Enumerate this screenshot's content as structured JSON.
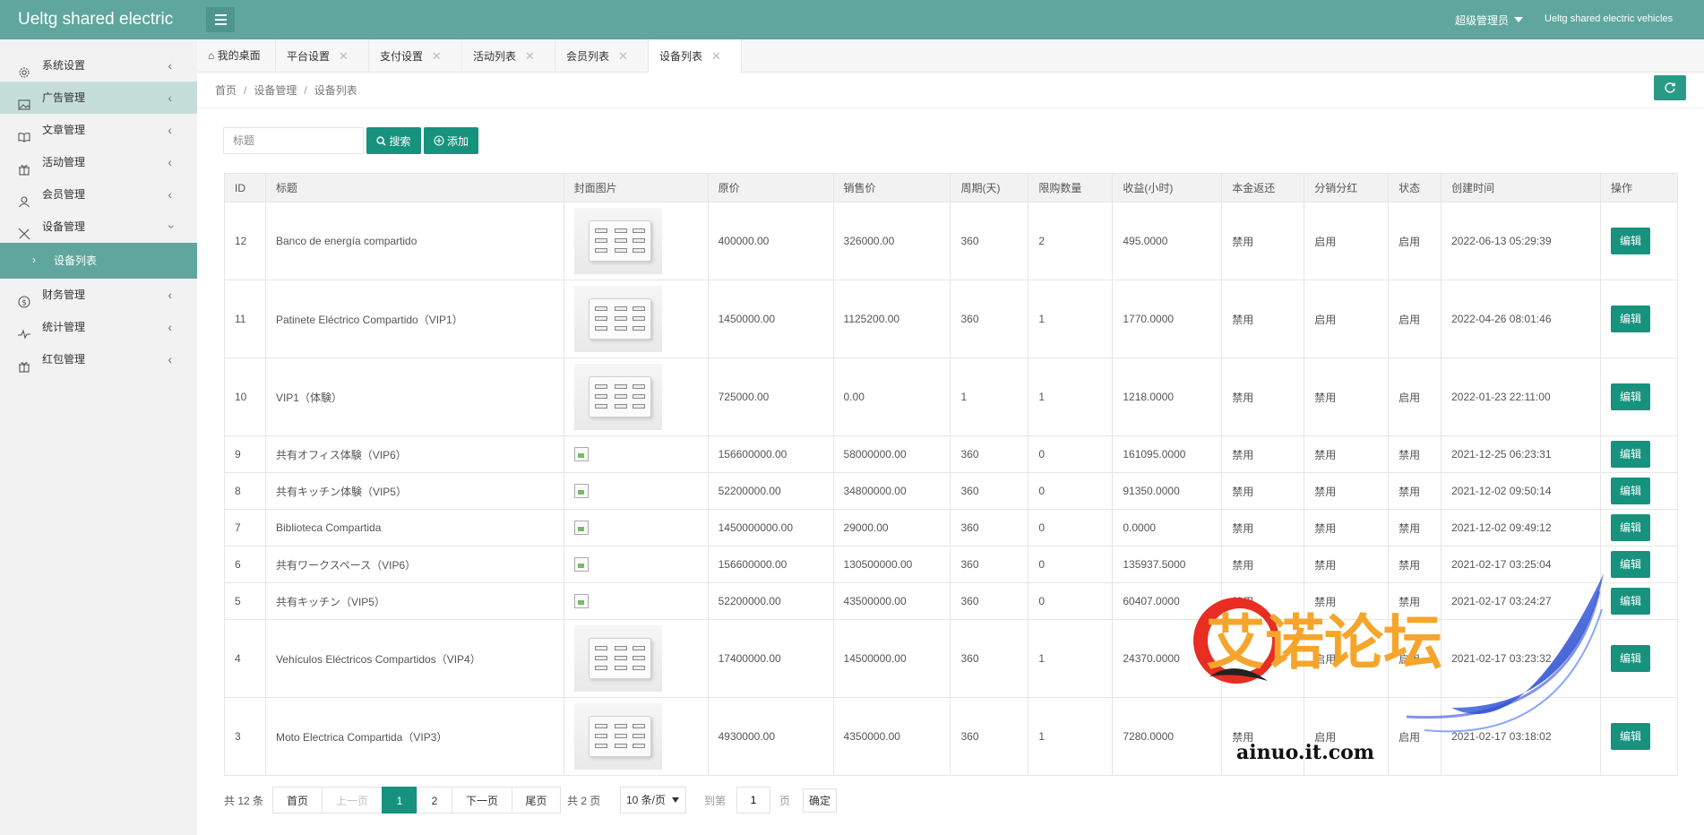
{
  "header": {
    "brand": "Ueltg shared electric",
    "admin_label": "超级管理员",
    "site_name": "Ueltg shared electric vehicles",
    "accent_color": "#5fa69f",
    "button_color": "#16927e"
  },
  "sidebar": {
    "items": [
      {
        "label": "系统设置",
        "icon": "gear-icon"
      },
      {
        "label": "广告管理",
        "icon": "image-icon"
      },
      {
        "label": "文章管理",
        "icon": "book-icon"
      },
      {
        "label": "活动管理",
        "icon": "gift-icon"
      },
      {
        "label": "会员管理",
        "icon": "user-icon"
      },
      {
        "label": "设备管理",
        "icon": "tools-icon"
      },
      {
        "label": "设备列表",
        "icon": "chevron-right-icon"
      },
      {
        "label": "财务管理",
        "icon": "dollar-icon"
      },
      {
        "label": "统计管理",
        "icon": "pulse-icon"
      },
      {
        "label": "红包管理",
        "icon": "gift-icon"
      }
    ]
  },
  "tabs": [
    {
      "label": "我的桌面"
    },
    {
      "label": "平台设置"
    },
    {
      "label": "支付设置"
    },
    {
      "label": "活动列表"
    },
    {
      "label": "会员列表"
    },
    {
      "label": "设备列表"
    }
  ],
  "breadcrumb": {
    "home": "首页",
    "section": "设备管理",
    "page": "设备列表"
  },
  "toolbar": {
    "search_placeholder": "标题",
    "search_label": "搜索",
    "add_label": "添加"
  },
  "table": {
    "headers": [
      "ID",
      "标题",
      "封面图片",
      "原价",
      "销售价",
      "周期(天)",
      "限购数量",
      "收益(小时)",
      "本金返还",
      "分销分红",
      "状态",
      "创建时间",
      "操作"
    ],
    "edit_label": "编辑",
    "rows": [
      {
        "id": "12",
        "title": "Banco de energía compartido",
        "image": "device",
        "price": "400000.00",
        "sale": "326000.00",
        "cycle": "360",
        "limit": "2",
        "income": "495.0000",
        "principal": "禁用",
        "principal_on": false,
        "dist": "启用",
        "dist_on": true,
        "status": "启用",
        "status_on": true,
        "created": "2022-06-13 05:29:39"
      },
      {
        "id": "11",
        "title": "Patinete Eléctrico Compartido（VIP1）",
        "image": "device",
        "price": "1450000.00",
        "sale": "1125200.00",
        "cycle": "360",
        "limit": "1",
        "income": "1770.0000",
        "principal": "禁用",
        "principal_on": false,
        "dist": "启用",
        "dist_on": true,
        "status": "启用",
        "status_on": true,
        "created": "2022-04-26 08:01:46"
      },
      {
        "id": "10",
        "title": "VIP1（体験）",
        "image": "device",
        "price": "725000.00",
        "sale": "0.00",
        "cycle": "1",
        "limit": "1",
        "income": "1218.0000",
        "principal": "禁用",
        "principal_on": false,
        "dist": "禁用",
        "dist_on": false,
        "status": "启用",
        "status_on": true,
        "created": "2022-01-23 22:11:00"
      },
      {
        "id": "9",
        "title": "共有オフィス体験（VIP6）",
        "image": "broken",
        "price": "156600000.00",
        "sale": "58000000.00",
        "cycle": "360",
        "limit": "0",
        "income": "161095.0000",
        "principal": "禁用",
        "principal_on": false,
        "dist": "禁用",
        "dist_on": false,
        "status": "禁用",
        "status_on": false,
        "created": "2021-12-25 06:23:31"
      },
      {
        "id": "8",
        "title": "共有キッチン体験（VIP5）",
        "image": "broken",
        "price": "52200000.00",
        "sale": "34800000.00",
        "cycle": "360",
        "limit": "0",
        "income": "91350.0000",
        "principal": "禁用",
        "principal_on": false,
        "dist": "禁用",
        "dist_on": false,
        "status": "禁用",
        "status_on": false,
        "created": "2021-12-02 09:50:14"
      },
      {
        "id": "7",
        "title": "Biblioteca Compartida",
        "image": "broken",
        "price": "1450000000.00",
        "sale": "29000.00",
        "cycle": "360",
        "limit": "0",
        "income": "0.0000",
        "principal": "禁用",
        "principal_on": false,
        "dist": "禁用",
        "dist_on": false,
        "status": "禁用",
        "status_on": false,
        "created": "2021-12-02 09:49:12"
      },
      {
        "id": "6",
        "title": "共有ワークスペース（VIP6）",
        "image": "broken",
        "price": "156600000.00",
        "sale": "130500000.00",
        "cycle": "360",
        "limit": "0",
        "income": "135937.5000",
        "principal": "禁用",
        "principal_on": false,
        "dist": "禁用",
        "dist_on": false,
        "status": "禁用",
        "status_on": false,
        "created": "2021-02-17 03:25:04"
      },
      {
        "id": "5",
        "title": "共有キッチン（VIP5）",
        "image": "broken",
        "price": "52200000.00",
        "sale": "43500000.00",
        "cycle": "360",
        "limit": "0",
        "income": "60407.0000",
        "principal": "禁用",
        "principal_on": false,
        "dist": "禁用",
        "dist_on": false,
        "status": "禁用",
        "status_on": false,
        "created": "2021-02-17 03:24:27"
      },
      {
        "id": "4",
        "title": "Vehículos Eléctricos Compartidos（VIP4）",
        "image": "device",
        "price": "17400000.00",
        "sale": "14500000.00",
        "cycle": "360",
        "limit": "1",
        "income": "24370.0000",
        "principal": "禁用",
        "principal_on": false,
        "dist": "启用",
        "dist_on": true,
        "status": "启用",
        "status_on": true,
        "created": "2021-02-17 03:23:32"
      },
      {
        "id": "3",
        "title": "Moto Electrica Compartida（VIP3）",
        "image": "device",
        "price": "4930000.00",
        "sale": "4350000.00",
        "cycle": "360",
        "limit": "1",
        "income": "7280.0000",
        "principal": "禁用",
        "principal_on": false,
        "dist": "启用",
        "dist_on": true,
        "status": "启用",
        "status_on": true,
        "created": "2021-02-17 03:18:02"
      }
    ]
  },
  "pagination": {
    "total": "共 12 条",
    "first": "首页",
    "prev": "上一页",
    "page1": "1",
    "page2": "2",
    "next": "下一页",
    "last": "尾页",
    "pages": "共 2 页",
    "per_page": "10 条/页",
    "goto": "到第",
    "goto_value": "1",
    "page_unit": "页",
    "confirm": "确定"
  },
  "watermark": {
    "title": "艾诺论坛",
    "url": "ainuo.it.com"
  }
}
